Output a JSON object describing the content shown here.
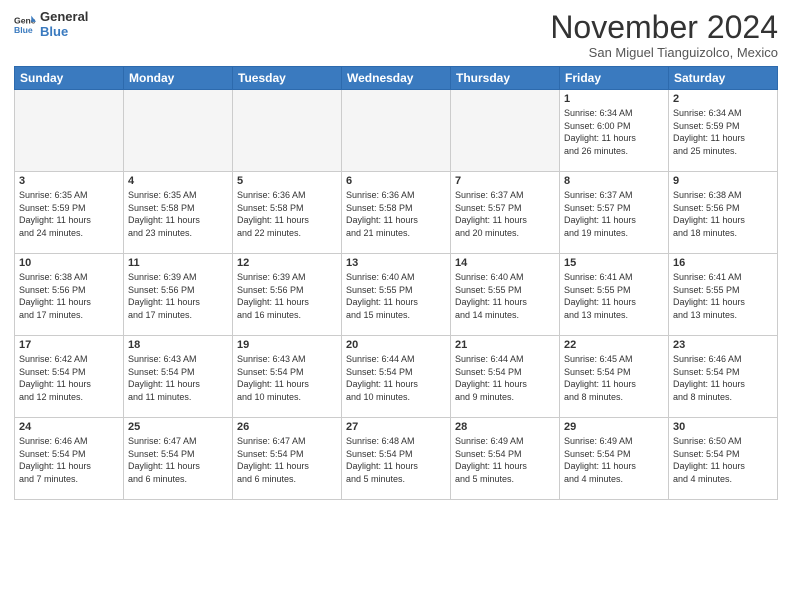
{
  "header": {
    "logo_line1": "General",
    "logo_line2": "Blue",
    "month": "November 2024",
    "location": "San Miguel Tianguizolco, Mexico"
  },
  "weekdays": [
    "Sunday",
    "Monday",
    "Tuesday",
    "Wednesday",
    "Thursday",
    "Friday",
    "Saturday"
  ],
  "weeks": [
    [
      {
        "day": "",
        "info": "",
        "empty": true
      },
      {
        "day": "",
        "info": "",
        "empty": true
      },
      {
        "day": "",
        "info": "",
        "empty": true
      },
      {
        "day": "",
        "info": "",
        "empty": true
      },
      {
        "day": "",
        "info": "",
        "empty": true
      },
      {
        "day": "1",
        "info": "Sunrise: 6:34 AM\nSunset: 6:00 PM\nDaylight: 11 hours\nand 26 minutes.",
        "empty": false
      },
      {
        "day": "2",
        "info": "Sunrise: 6:34 AM\nSunset: 5:59 PM\nDaylight: 11 hours\nand 25 minutes.",
        "empty": false
      }
    ],
    [
      {
        "day": "3",
        "info": "Sunrise: 6:35 AM\nSunset: 5:59 PM\nDaylight: 11 hours\nand 24 minutes.",
        "empty": false
      },
      {
        "day": "4",
        "info": "Sunrise: 6:35 AM\nSunset: 5:58 PM\nDaylight: 11 hours\nand 23 minutes.",
        "empty": false
      },
      {
        "day": "5",
        "info": "Sunrise: 6:36 AM\nSunset: 5:58 PM\nDaylight: 11 hours\nand 22 minutes.",
        "empty": false
      },
      {
        "day": "6",
        "info": "Sunrise: 6:36 AM\nSunset: 5:58 PM\nDaylight: 11 hours\nand 21 minutes.",
        "empty": false
      },
      {
        "day": "7",
        "info": "Sunrise: 6:37 AM\nSunset: 5:57 PM\nDaylight: 11 hours\nand 20 minutes.",
        "empty": false
      },
      {
        "day": "8",
        "info": "Sunrise: 6:37 AM\nSunset: 5:57 PM\nDaylight: 11 hours\nand 19 minutes.",
        "empty": false
      },
      {
        "day": "9",
        "info": "Sunrise: 6:38 AM\nSunset: 5:56 PM\nDaylight: 11 hours\nand 18 minutes.",
        "empty": false
      }
    ],
    [
      {
        "day": "10",
        "info": "Sunrise: 6:38 AM\nSunset: 5:56 PM\nDaylight: 11 hours\nand 17 minutes.",
        "empty": false
      },
      {
        "day": "11",
        "info": "Sunrise: 6:39 AM\nSunset: 5:56 PM\nDaylight: 11 hours\nand 17 minutes.",
        "empty": false
      },
      {
        "day": "12",
        "info": "Sunrise: 6:39 AM\nSunset: 5:56 PM\nDaylight: 11 hours\nand 16 minutes.",
        "empty": false
      },
      {
        "day": "13",
        "info": "Sunrise: 6:40 AM\nSunset: 5:55 PM\nDaylight: 11 hours\nand 15 minutes.",
        "empty": false
      },
      {
        "day": "14",
        "info": "Sunrise: 6:40 AM\nSunset: 5:55 PM\nDaylight: 11 hours\nand 14 minutes.",
        "empty": false
      },
      {
        "day": "15",
        "info": "Sunrise: 6:41 AM\nSunset: 5:55 PM\nDaylight: 11 hours\nand 13 minutes.",
        "empty": false
      },
      {
        "day": "16",
        "info": "Sunrise: 6:41 AM\nSunset: 5:55 PM\nDaylight: 11 hours\nand 13 minutes.",
        "empty": false
      }
    ],
    [
      {
        "day": "17",
        "info": "Sunrise: 6:42 AM\nSunset: 5:54 PM\nDaylight: 11 hours\nand 12 minutes.",
        "empty": false
      },
      {
        "day": "18",
        "info": "Sunrise: 6:43 AM\nSunset: 5:54 PM\nDaylight: 11 hours\nand 11 minutes.",
        "empty": false
      },
      {
        "day": "19",
        "info": "Sunrise: 6:43 AM\nSunset: 5:54 PM\nDaylight: 11 hours\nand 10 minutes.",
        "empty": false
      },
      {
        "day": "20",
        "info": "Sunrise: 6:44 AM\nSunset: 5:54 PM\nDaylight: 11 hours\nand 10 minutes.",
        "empty": false
      },
      {
        "day": "21",
        "info": "Sunrise: 6:44 AM\nSunset: 5:54 PM\nDaylight: 11 hours\nand 9 minutes.",
        "empty": false
      },
      {
        "day": "22",
        "info": "Sunrise: 6:45 AM\nSunset: 5:54 PM\nDaylight: 11 hours\nand 8 minutes.",
        "empty": false
      },
      {
        "day": "23",
        "info": "Sunrise: 6:46 AM\nSunset: 5:54 PM\nDaylight: 11 hours\nand 8 minutes.",
        "empty": false
      }
    ],
    [
      {
        "day": "24",
        "info": "Sunrise: 6:46 AM\nSunset: 5:54 PM\nDaylight: 11 hours\nand 7 minutes.",
        "empty": false
      },
      {
        "day": "25",
        "info": "Sunrise: 6:47 AM\nSunset: 5:54 PM\nDaylight: 11 hours\nand 6 minutes.",
        "empty": false
      },
      {
        "day": "26",
        "info": "Sunrise: 6:47 AM\nSunset: 5:54 PM\nDaylight: 11 hours\nand 6 minutes.",
        "empty": false
      },
      {
        "day": "27",
        "info": "Sunrise: 6:48 AM\nSunset: 5:54 PM\nDaylight: 11 hours\nand 5 minutes.",
        "empty": false
      },
      {
        "day": "28",
        "info": "Sunrise: 6:49 AM\nSunset: 5:54 PM\nDaylight: 11 hours\nand 5 minutes.",
        "empty": false
      },
      {
        "day": "29",
        "info": "Sunrise: 6:49 AM\nSunset: 5:54 PM\nDaylight: 11 hours\nand 4 minutes.",
        "empty": false
      },
      {
        "day": "30",
        "info": "Sunrise: 6:50 AM\nSunset: 5:54 PM\nDaylight: 11 hours\nand 4 minutes.",
        "empty": false
      }
    ]
  ]
}
